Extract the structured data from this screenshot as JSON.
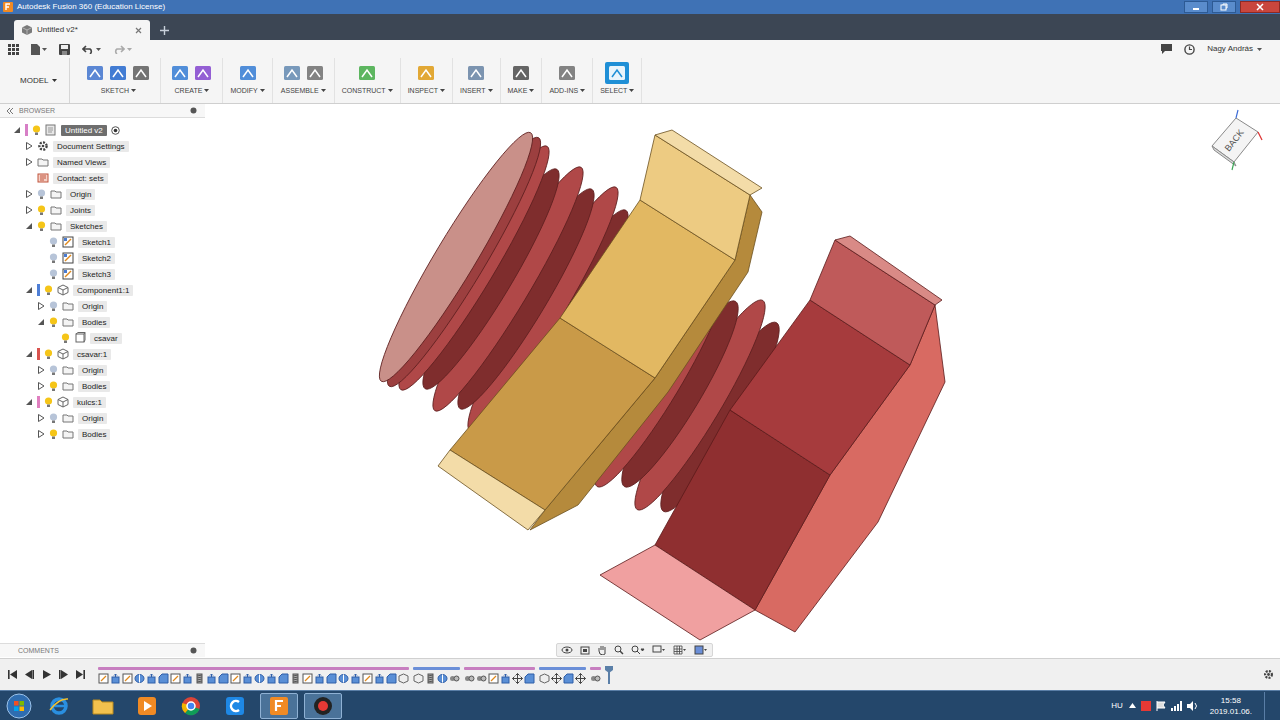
{
  "window": {
    "title": "Autodesk Fusion 360 (Education License)"
  },
  "tabs": [
    {
      "label": "Untitled v2*",
      "selected": true
    }
  ],
  "user": {
    "name": "Nagy András"
  },
  "workspace": {
    "label": "MODEL"
  },
  "toolbar": [
    {
      "label": "SKETCH",
      "selected": false
    },
    {
      "label": "CREATE",
      "selected": false
    },
    {
      "label": "MODIFY",
      "selected": false
    },
    {
      "label": "ASSEMBLE",
      "selected": false
    },
    {
      "label": "CONSTRUCT",
      "selected": false
    },
    {
      "label": "INSPECT",
      "selected": false
    },
    {
      "label": "INSERT",
      "selected": false
    },
    {
      "label": "MAKE",
      "selected": false
    },
    {
      "label": "ADD-INS",
      "selected": false
    },
    {
      "label": "SELECT",
      "selected": true
    }
  ],
  "browser": {
    "title": "BROWSER",
    "items": [
      {
        "label": "Untitled v2",
        "depth": 0,
        "kind": "document",
        "has_children": true,
        "expanded": true,
        "bulb": true,
        "visible": true,
        "active": true,
        "color": "#d77fc6"
      },
      {
        "label": "Document Settings",
        "depth": 1,
        "kind": "settings",
        "has_children": true,
        "expanded": false,
        "bulb": false,
        "visible": true,
        "active": false
      },
      {
        "label": "Named Views",
        "depth": 1,
        "kind": "folder",
        "has_children": true,
        "expanded": false,
        "bulb": false,
        "visible": true,
        "active": false
      },
      {
        "label": "Contact: sets",
        "depth": 1,
        "kind": "contact",
        "has_children": false,
        "expanded": false,
        "bulb": false,
        "visible": true,
        "active": false
      },
      {
        "label": "Origin",
        "depth": 1,
        "kind": "folder",
        "has_children": true,
        "expanded": false,
        "bulb": true,
        "visible": false,
        "active": false
      },
      {
        "label": "Joints",
        "depth": 1,
        "kind": "folder",
        "has_children": true,
        "expanded": false,
        "bulb": true,
        "visible": true,
        "active": false
      },
      {
        "label": "Sketches",
        "depth": 1,
        "kind": "folder",
        "has_children": true,
        "expanded": true,
        "bulb": true,
        "visible": true,
        "active": false
      },
      {
        "label": "Sketch1",
        "depth": 2,
        "kind": "sketch",
        "has_children": false,
        "expanded": false,
        "bulb": true,
        "visible": false,
        "active": false
      },
      {
        "label": "Sketch2",
        "depth": 2,
        "kind": "sketch",
        "has_children": false,
        "expanded": false,
        "bulb": true,
        "visible": false,
        "active": false
      },
      {
        "label": "Sketch3",
        "depth": 2,
        "kind": "sketch",
        "has_children": false,
        "expanded": false,
        "bulb": true,
        "visible": false,
        "active": false
      },
      {
        "label": "Component1:1",
        "depth": 1,
        "kind": "component",
        "has_children": true,
        "expanded": true,
        "bulb": true,
        "visible": true,
        "active": false,
        "color": "#4f7fd6"
      },
      {
        "label": "Origin",
        "depth": 2,
        "kind": "folder",
        "has_children": true,
        "expanded": false,
        "bulb": true,
        "visible": false,
        "active": false
      },
      {
        "label": "Bodies",
        "depth": 2,
        "kind": "folder",
        "has_children": true,
        "expanded": true,
        "bulb": true,
        "visible": true,
        "active": false
      },
      {
        "label": "csavar",
        "depth": 3,
        "kind": "body",
        "has_children": false,
        "expanded": false,
        "bulb": true,
        "visible": true,
        "active": false
      },
      {
        "label": "csavar:1",
        "depth": 1,
        "kind": "component",
        "has_children": true,
        "expanded": true,
        "bulb": true,
        "visible": true,
        "active": false,
        "color": "#d9534f"
      },
      {
        "label": "Origin",
        "depth": 2,
        "kind": "folder",
        "has_children": true,
        "expanded": false,
        "bulb": true,
        "visible": false,
        "active": false
      },
      {
        "label": "Bodies",
        "depth": 2,
        "kind": "folder",
        "has_children": true,
        "expanded": false,
        "bulb": true,
        "visible": true,
        "active": false
      },
      {
        "label": "kulcs:1",
        "depth": 1,
        "kind": "component",
        "has_children": true,
        "expanded": true,
        "bulb": true,
        "visible": true,
        "active": false,
        "color": "#e07fc0"
      },
      {
        "label": "Origin",
        "depth": 2,
        "kind": "folder",
        "has_children": true,
        "expanded": false,
        "bulb": true,
        "visible": false,
        "active": false
      },
      {
        "label": "Bodies",
        "depth": 2,
        "kind": "folder",
        "has_children": true,
        "expanded": false,
        "bulb": true,
        "visible": true,
        "active": false
      }
    ]
  },
  "viewcube": {
    "face": "BACK"
  },
  "comments": {
    "title": "COMMENTS"
  },
  "timeline": {
    "groups": [
      {
        "color": "#c77ec0",
        "features": [
          {
            "kind": "sketch"
          },
          {
            "kind": "extrude"
          },
          {
            "kind": "sketch"
          },
          {
            "kind": "revolve"
          },
          {
            "kind": "extrude"
          },
          {
            "kind": "chamfer"
          },
          {
            "kind": "sketch"
          },
          {
            "kind": "extrude"
          },
          {
            "kind": "thread"
          },
          {
            "kind": "extrude"
          },
          {
            "kind": "chamfer"
          },
          {
            "kind": "sketch"
          },
          {
            "kind": "extrude"
          },
          {
            "kind": "revolve"
          },
          {
            "kind": "extrude"
          },
          {
            "kind": "chamfer"
          },
          {
            "kind": "thread"
          },
          {
            "kind": "sketch"
          },
          {
            "kind": "extrude"
          },
          {
            "kind": "chamfer"
          },
          {
            "kind": "revolve"
          },
          {
            "kind": "extrude"
          },
          {
            "kind": "sketch"
          },
          {
            "kind": "extrude"
          },
          {
            "kind": "chamfer"
          },
          {
            "kind": "component"
          }
        ]
      },
      {
        "color": "#6b8fd8",
        "features": [
          {
            "kind": "component"
          },
          {
            "kind": "thread"
          },
          {
            "kind": "revolve"
          },
          {
            "kind": "joint"
          }
        ]
      },
      {
        "color": "#c77ec0",
        "features": [
          {
            "kind": "joint"
          },
          {
            "kind": "joint"
          },
          {
            "kind": "sketch"
          },
          {
            "kind": "extrude"
          },
          {
            "kind": "move"
          },
          {
            "kind": "chamfer"
          }
        ]
      },
      {
        "color": "#6b8fd8",
        "features": [
          {
            "kind": "component"
          },
          {
            "kind": "move"
          },
          {
            "kind": "chamfer"
          },
          {
            "kind": "move"
          }
        ]
      },
      {
        "color": "#c77ec0",
        "features": [
          {
            "kind": "joint"
          }
        ]
      }
    ]
  },
  "taskbar": {
    "language": "HU",
    "time": "15:58",
    "date": "2019.01.06."
  }
}
